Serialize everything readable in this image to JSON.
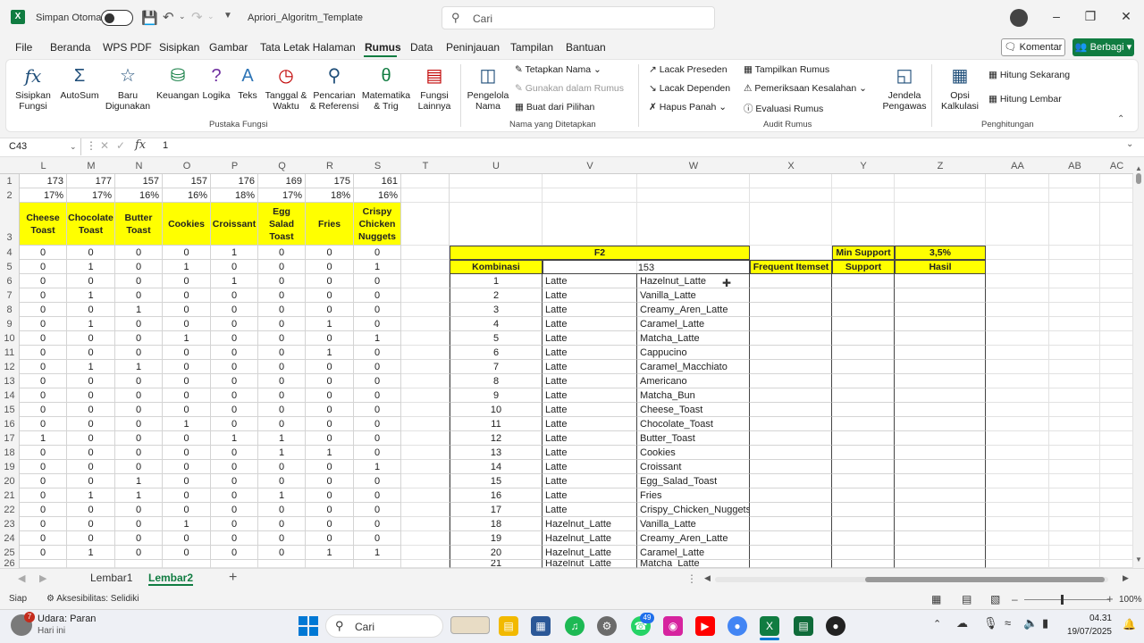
{
  "titlebar": {
    "autosave_label": "Simpan Otomatis",
    "filename": "Apriori_Algoritm_Template",
    "search_placeholder": "Cari"
  },
  "menu": [
    "File",
    "Beranda",
    "WPS PDF",
    "Sisipkan",
    "Gambar",
    "Tata Letak Halaman",
    "Rumus",
    "Data",
    "Peninjauan",
    "Tampilan",
    "Bantuan"
  ],
  "menu_active": "Rumus",
  "share": {
    "komentar": "Komentar",
    "berbagi": "Berbagi"
  },
  "ribbon": {
    "fx_insert": "Sisipkan Fungsi",
    "autosum": "AutoSum",
    "recent": "Baru Digunakan",
    "financial": "Keuangan",
    "logical": "Logika",
    "text": "Teks",
    "datetime": "Tanggal & Waktu",
    "lookup": "Pencarian & Referensi",
    "math": "Matematika & Trig",
    "more": "Fungsi Lainnya",
    "group1": "Pustaka Fungsi",
    "name_manager": "Pengelola Nama",
    "define_name": "Tetapkan Nama",
    "use_in_formula": "Gunakan dalam Rumus",
    "create_sel": "Buat dari Pilihan",
    "group2": "Nama yang Ditetapkan",
    "trace_prec": "Lacak Preseden",
    "trace_dep": "Lacak Dependen",
    "remove_arrows": "Hapus Panah",
    "show_formulas": "Tampilkan Rumus",
    "error_check": "Pemeriksaan Kesalahan",
    "eval_formula": "Evaluasi Rumus",
    "watch": "Jendela Pengawas",
    "group3": "Audit Rumus",
    "calc_options": "Opsi Kalkulasi",
    "calc_now": "Hitung Sekarang",
    "calc_sheet": "Hitung Lembar",
    "group4": "Penghitungan"
  },
  "formula_bar": {
    "name_box": "C43",
    "value": "1"
  },
  "columns_left": [
    "L",
    "M",
    "N",
    "O",
    "P",
    "Q",
    "R",
    "S",
    "T"
  ],
  "columns_right": [
    "U",
    "V",
    "W",
    "X",
    "Y",
    "Z",
    "AA",
    "AB",
    "AC"
  ],
  "row_numbers": [
    "1",
    "2",
    "3",
    "4",
    "5",
    "6",
    "7",
    "8",
    "9",
    "10",
    "11",
    "12",
    "13",
    "14",
    "15",
    "16",
    "17",
    "18",
    "19",
    "20",
    "21",
    "22",
    "23",
    "24",
    "25",
    "26"
  ],
  "left_table": {
    "row1": [
      "173",
      "177",
      "157",
      "157",
      "176",
      "169",
      "175",
      "161"
    ],
    "row2": [
      "17%",
      "17%",
      "16%",
      "16%",
      "18%",
      "17%",
      "18%",
      "16%"
    ],
    "headers": [
      "Cheese Toast",
      "Chocolate Toast",
      "Butter Toast",
      "Cookies",
      "Croissant",
      "Egg Salad Toast",
      "Fries",
      "Crispy Chicken Nuggets"
    ],
    "data": [
      [
        "0",
        "0",
        "0",
        "0",
        "1",
        "0",
        "0",
        "0"
      ],
      [
        "0",
        "1",
        "0",
        "1",
        "0",
        "0",
        "0",
        "1"
      ],
      [
        "0",
        "0",
        "0",
        "0",
        "1",
        "0",
        "0",
        "0"
      ],
      [
        "0",
        "1",
        "0",
        "0",
        "0",
        "0",
        "0",
        "0"
      ],
      [
        "0",
        "0",
        "1",
        "0",
        "0",
        "0",
        "0",
        "0"
      ],
      [
        "0",
        "1",
        "0",
        "0",
        "0",
        "0",
        "1",
        "0"
      ],
      [
        "0",
        "0",
        "0",
        "1",
        "0",
        "0",
        "0",
        "1"
      ],
      [
        "0",
        "0",
        "0",
        "0",
        "0",
        "0",
        "1",
        "0"
      ],
      [
        "0",
        "1",
        "1",
        "0",
        "0",
        "0",
        "0",
        "0"
      ],
      [
        "0",
        "0",
        "0",
        "0",
        "0",
        "0",
        "0",
        "0"
      ],
      [
        "0",
        "0",
        "0",
        "0",
        "0",
        "0",
        "0",
        "0"
      ],
      [
        "0",
        "0",
        "0",
        "0",
        "0",
        "0",
        "0",
        "0"
      ],
      [
        "0",
        "0",
        "0",
        "1",
        "0",
        "0",
        "0",
        "0"
      ],
      [
        "1",
        "0",
        "0",
        "0",
        "1",
        "1",
        "0",
        "0"
      ],
      [
        "0",
        "0",
        "0",
        "0",
        "0",
        "1",
        "1",
        "0"
      ],
      [
        "0",
        "0",
        "0",
        "0",
        "0",
        "0",
        "0",
        "1"
      ],
      [
        "0",
        "0",
        "1",
        "0",
        "0",
        "0",
        "0",
        "0"
      ],
      [
        "0",
        "1",
        "1",
        "0",
        "0",
        "1",
        "0",
        "0"
      ],
      [
        "0",
        "0",
        "0",
        "0",
        "0",
        "0",
        "0",
        "0"
      ],
      [
        "0",
        "0",
        "0",
        "1",
        "0",
        "0",
        "0",
        "0"
      ],
      [
        "0",
        "0",
        "0",
        "0",
        "0",
        "0",
        "0",
        "0"
      ],
      [
        "0",
        "1",
        "0",
        "0",
        "0",
        "0",
        "1",
        "1"
      ]
    ]
  },
  "right_table": {
    "title": "F2",
    "min_support_label": "Min Support",
    "min_support_value": "3,5%",
    "col_kombinasi": "Kombinasi",
    "col_count": "153",
    "col_frequent": "Frequent Itemset",
    "col_support": "Support",
    "col_hasil": "Hasil",
    "rows": [
      [
        "1",
        "Latte",
        "Hazelnut_Latte"
      ],
      [
        "2",
        "Latte",
        "Vanilla_Latte"
      ],
      [
        "3",
        "Latte",
        "Creamy_Aren_Latte"
      ],
      [
        "4",
        "Latte",
        "Caramel_Latte"
      ],
      [
        "5",
        "Latte",
        "Matcha_Latte"
      ],
      [
        "6",
        "Latte",
        "Cappucino"
      ],
      [
        "7",
        "Latte",
        "Caramel_Macchiato"
      ],
      [
        "8",
        "Latte",
        "Americano"
      ],
      [
        "9",
        "Latte",
        "Matcha_Bun"
      ],
      [
        "10",
        "Latte",
        "Cheese_Toast"
      ],
      [
        "11",
        "Latte",
        "Chocolate_Toast"
      ],
      [
        "12",
        "Latte",
        "Butter_Toast"
      ],
      [
        "13",
        "Latte",
        "Cookies"
      ],
      [
        "14",
        "Latte",
        "Croissant"
      ],
      [
        "15",
        "Latte",
        "Egg_Salad_Toast"
      ],
      [
        "16",
        "Latte",
        "Fries"
      ],
      [
        "17",
        "Latte",
        "Crispy_Chicken_Nuggets"
      ],
      [
        "18",
        "Hazelnut_Latte",
        "Vanilla_Latte"
      ],
      [
        "19",
        "Hazelnut_Latte",
        "Creamy_Aren_Latte"
      ],
      [
        "20",
        "Hazelnut_Latte",
        "Caramel_Latte"
      ],
      [
        "21",
        "Hazelnut_Latte",
        "Matcha_Latte"
      ]
    ]
  },
  "sheets": [
    "Lembar1",
    "Lembar2"
  ],
  "active_sheet": "Lembar2",
  "status": {
    "ready": "Siap",
    "accessibility": "Aksesibilitas: Selidiki",
    "zoom": "100%"
  },
  "taskbar": {
    "weather_title": "Udara: Paran",
    "weather_sub": "Hari ini",
    "search": "Cari",
    "time": "04.31",
    "date": "19/07/2025",
    "badge_whatsapp": "49",
    "badge_weather": "7"
  }
}
